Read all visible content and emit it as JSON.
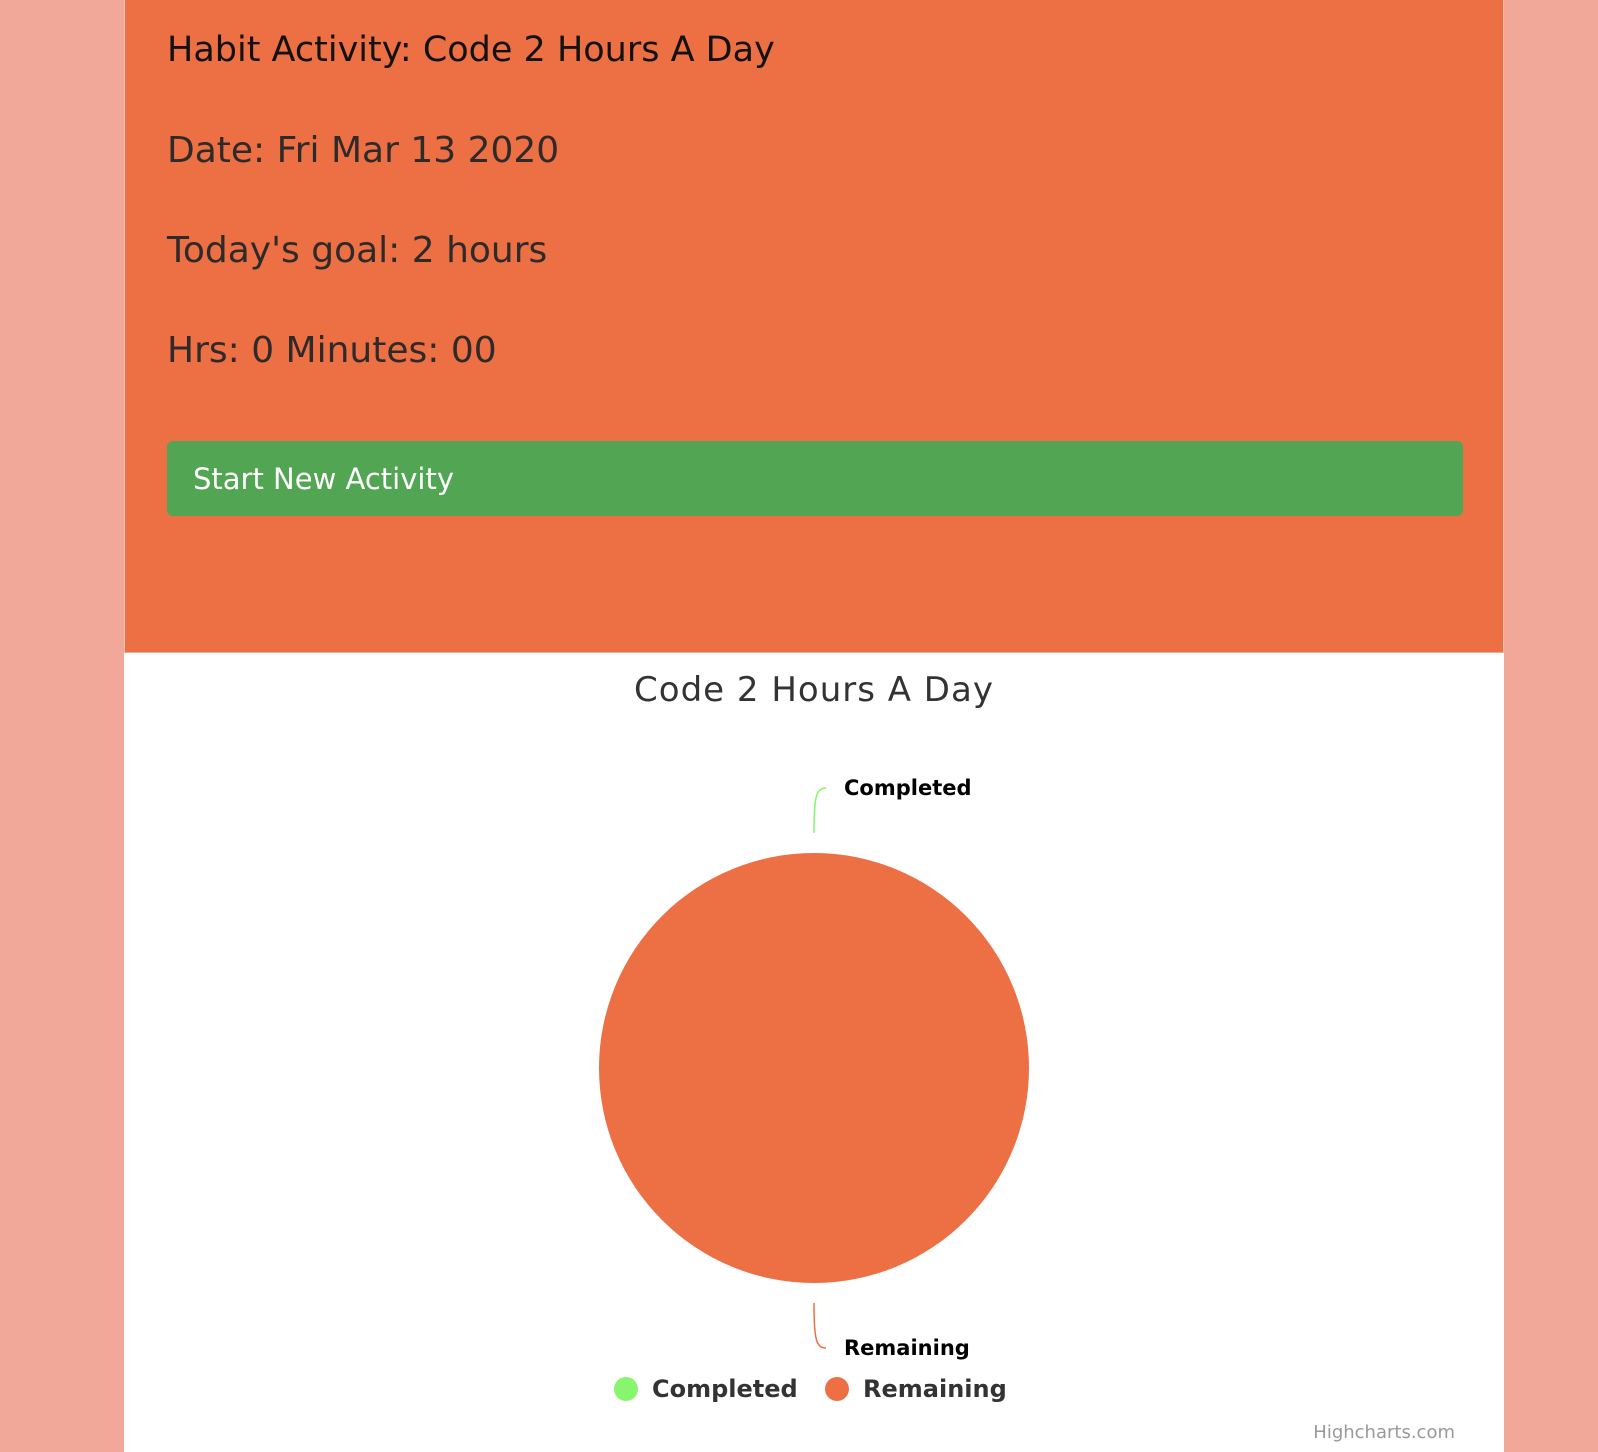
{
  "habit": {
    "title": "Habit Activity: Code 2 Hours A Day",
    "date": "Date: Fri Mar 13 2020",
    "goal": "Today's goal: 2 hours",
    "time": "Hrs: 0 Minutes: 00",
    "start_button_label": "Start New Activity"
  },
  "colors": {
    "page_background": "#f1a898",
    "card_background": "#ed7045",
    "button_background": "#52a552",
    "completed": "#87f56e",
    "remaining": "#ed7045"
  },
  "chart_data": {
    "type": "pie",
    "title": "Code 2 Hours A Day",
    "series": [
      {
        "data": [
          {
            "name": "Completed",
            "y": 0,
            "color": "#87f56e"
          },
          {
            "name": "Remaining",
            "y": 2,
            "color": "#ed7045"
          }
        ]
      }
    ],
    "legend": {
      "placement": "bottom-center",
      "items": [
        "Completed",
        "Remaining"
      ]
    },
    "credits": "Highcharts.com"
  }
}
